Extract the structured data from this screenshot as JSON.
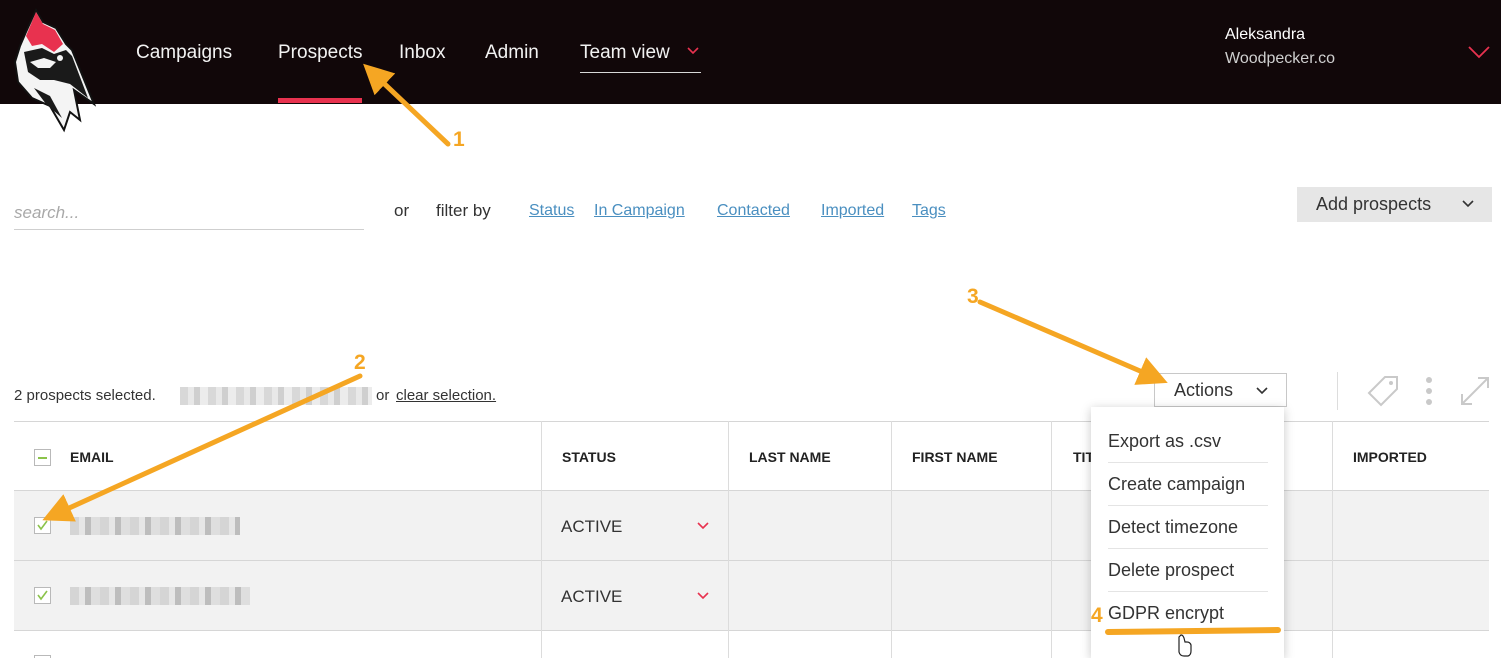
{
  "colors": {
    "topbar": "#110709",
    "accent": "#e8324f",
    "annotation": "#f5a623",
    "link": "#4a8fc0"
  },
  "nav": {
    "items": [
      {
        "label": "Campaigns"
      },
      {
        "label": "Prospects"
      },
      {
        "label": "Inbox"
      },
      {
        "label": "Admin"
      }
    ],
    "team_view": "Team view"
  },
  "user": {
    "name": "Aleksandra",
    "company": "Woodpecker.co"
  },
  "filter": {
    "search_placeholder": "search...",
    "or": "or",
    "filter_by": "filter by",
    "links": [
      "Status",
      "In Campaign",
      "Contacted",
      "Imported",
      "Tags"
    ],
    "add_button": "Add prospects"
  },
  "selection": {
    "text": "2 prospects selected.",
    "or": "or",
    "clear": "clear selection."
  },
  "actions": {
    "button": "Actions",
    "menu": [
      "Export as .csv",
      "Create campaign",
      "Detect timezone",
      "Delete prospect",
      "GDPR encrypt"
    ]
  },
  "table": {
    "headers": [
      "EMAIL",
      "STATUS",
      "LAST NAME",
      "FIRST NAME",
      "TIT",
      "IMPORTED"
    ],
    "rows": [
      {
        "status": "ACTIVE",
        "checked": true
      },
      {
        "status": "ACTIVE",
        "checked": true
      }
    ]
  },
  "annotations": [
    "1",
    "2",
    "3",
    "4"
  ]
}
